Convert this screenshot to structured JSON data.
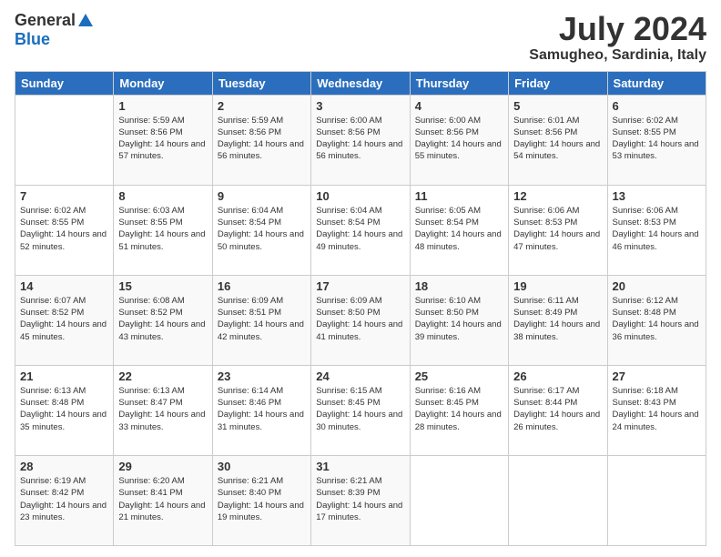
{
  "header": {
    "logo_general": "General",
    "logo_blue": "Blue",
    "month_year": "July 2024",
    "location": "Samugheo, Sardinia, Italy"
  },
  "days_of_week": [
    "Sunday",
    "Monday",
    "Tuesday",
    "Wednesday",
    "Thursday",
    "Friday",
    "Saturday"
  ],
  "weeks": [
    [
      {
        "day": "",
        "sunrise": "",
        "sunset": "",
        "daylight": ""
      },
      {
        "day": "1",
        "sunrise": "Sunrise: 5:59 AM",
        "sunset": "Sunset: 8:56 PM",
        "daylight": "Daylight: 14 hours and 57 minutes."
      },
      {
        "day": "2",
        "sunrise": "Sunrise: 5:59 AM",
        "sunset": "Sunset: 8:56 PM",
        "daylight": "Daylight: 14 hours and 56 minutes."
      },
      {
        "day": "3",
        "sunrise": "Sunrise: 6:00 AM",
        "sunset": "Sunset: 8:56 PM",
        "daylight": "Daylight: 14 hours and 56 minutes."
      },
      {
        "day": "4",
        "sunrise": "Sunrise: 6:00 AM",
        "sunset": "Sunset: 8:56 PM",
        "daylight": "Daylight: 14 hours and 55 minutes."
      },
      {
        "day": "5",
        "sunrise": "Sunrise: 6:01 AM",
        "sunset": "Sunset: 8:56 PM",
        "daylight": "Daylight: 14 hours and 54 minutes."
      },
      {
        "day": "6",
        "sunrise": "Sunrise: 6:02 AM",
        "sunset": "Sunset: 8:55 PM",
        "daylight": "Daylight: 14 hours and 53 minutes."
      }
    ],
    [
      {
        "day": "7",
        "sunrise": "Sunrise: 6:02 AM",
        "sunset": "Sunset: 8:55 PM",
        "daylight": "Daylight: 14 hours and 52 minutes."
      },
      {
        "day": "8",
        "sunrise": "Sunrise: 6:03 AM",
        "sunset": "Sunset: 8:55 PM",
        "daylight": "Daylight: 14 hours and 51 minutes."
      },
      {
        "day": "9",
        "sunrise": "Sunrise: 6:04 AM",
        "sunset": "Sunset: 8:54 PM",
        "daylight": "Daylight: 14 hours and 50 minutes."
      },
      {
        "day": "10",
        "sunrise": "Sunrise: 6:04 AM",
        "sunset": "Sunset: 8:54 PM",
        "daylight": "Daylight: 14 hours and 49 minutes."
      },
      {
        "day": "11",
        "sunrise": "Sunrise: 6:05 AM",
        "sunset": "Sunset: 8:54 PM",
        "daylight": "Daylight: 14 hours and 48 minutes."
      },
      {
        "day": "12",
        "sunrise": "Sunrise: 6:06 AM",
        "sunset": "Sunset: 8:53 PM",
        "daylight": "Daylight: 14 hours and 47 minutes."
      },
      {
        "day": "13",
        "sunrise": "Sunrise: 6:06 AM",
        "sunset": "Sunset: 8:53 PM",
        "daylight": "Daylight: 14 hours and 46 minutes."
      }
    ],
    [
      {
        "day": "14",
        "sunrise": "Sunrise: 6:07 AM",
        "sunset": "Sunset: 8:52 PM",
        "daylight": "Daylight: 14 hours and 45 minutes."
      },
      {
        "day": "15",
        "sunrise": "Sunrise: 6:08 AM",
        "sunset": "Sunset: 8:52 PM",
        "daylight": "Daylight: 14 hours and 43 minutes."
      },
      {
        "day": "16",
        "sunrise": "Sunrise: 6:09 AM",
        "sunset": "Sunset: 8:51 PM",
        "daylight": "Daylight: 14 hours and 42 minutes."
      },
      {
        "day": "17",
        "sunrise": "Sunrise: 6:09 AM",
        "sunset": "Sunset: 8:50 PM",
        "daylight": "Daylight: 14 hours and 41 minutes."
      },
      {
        "day": "18",
        "sunrise": "Sunrise: 6:10 AM",
        "sunset": "Sunset: 8:50 PM",
        "daylight": "Daylight: 14 hours and 39 minutes."
      },
      {
        "day": "19",
        "sunrise": "Sunrise: 6:11 AM",
        "sunset": "Sunset: 8:49 PM",
        "daylight": "Daylight: 14 hours and 38 minutes."
      },
      {
        "day": "20",
        "sunrise": "Sunrise: 6:12 AM",
        "sunset": "Sunset: 8:48 PM",
        "daylight": "Daylight: 14 hours and 36 minutes."
      }
    ],
    [
      {
        "day": "21",
        "sunrise": "Sunrise: 6:13 AM",
        "sunset": "Sunset: 8:48 PM",
        "daylight": "Daylight: 14 hours and 35 minutes."
      },
      {
        "day": "22",
        "sunrise": "Sunrise: 6:13 AM",
        "sunset": "Sunset: 8:47 PM",
        "daylight": "Daylight: 14 hours and 33 minutes."
      },
      {
        "day": "23",
        "sunrise": "Sunrise: 6:14 AM",
        "sunset": "Sunset: 8:46 PM",
        "daylight": "Daylight: 14 hours and 31 minutes."
      },
      {
        "day": "24",
        "sunrise": "Sunrise: 6:15 AM",
        "sunset": "Sunset: 8:45 PM",
        "daylight": "Daylight: 14 hours and 30 minutes."
      },
      {
        "day": "25",
        "sunrise": "Sunrise: 6:16 AM",
        "sunset": "Sunset: 8:45 PM",
        "daylight": "Daylight: 14 hours and 28 minutes."
      },
      {
        "day": "26",
        "sunrise": "Sunrise: 6:17 AM",
        "sunset": "Sunset: 8:44 PM",
        "daylight": "Daylight: 14 hours and 26 minutes."
      },
      {
        "day": "27",
        "sunrise": "Sunrise: 6:18 AM",
        "sunset": "Sunset: 8:43 PM",
        "daylight": "Daylight: 14 hours and 24 minutes."
      }
    ],
    [
      {
        "day": "28",
        "sunrise": "Sunrise: 6:19 AM",
        "sunset": "Sunset: 8:42 PM",
        "daylight": "Daylight: 14 hours and 23 minutes."
      },
      {
        "day": "29",
        "sunrise": "Sunrise: 6:20 AM",
        "sunset": "Sunset: 8:41 PM",
        "daylight": "Daylight: 14 hours and 21 minutes."
      },
      {
        "day": "30",
        "sunrise": "Sunrise: 6:21 AM",
        "sunset": "Sunset: 8:40 PM",
        "daylight": "Daylight: 14 hours and 19 minutes."
      },
      {
        "day": "31",
        "sunrise": "Sunrise: 6:21 AM",
        "sunset": "Sunset: 8:39 PM",
        "daylight": "Daylight: 14 hours and 17 minutes."
      },
      {
        "day": "",
        "sunrise": "",
        "sunset": "",
        "daylight": ""
      },
      {
        "day": "",
        "sunrise": "",
        "sunset": "",
        "daylight": ""
      },
      {
        "day": "",
        "sunrise": "",
        "sunset": "",
        "daylight": ""
      }
    ]
  ]
}
